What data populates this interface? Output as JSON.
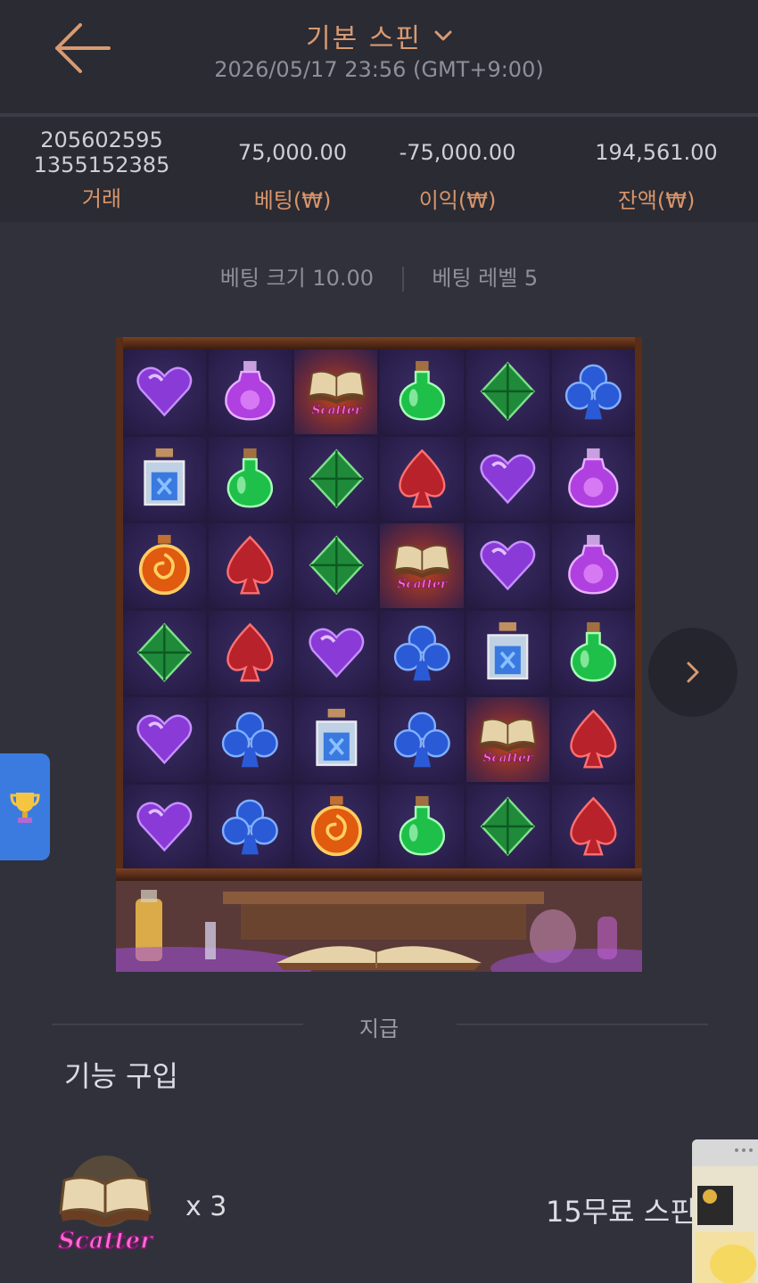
{
  "header": {
    "title": "기본 스핀",
    "datetime": "2026/05/17 23:56 (GMT+9:00)"
  },
  "summary": {
    "transaction": {
      "line1": "205602595",
      "line2": "1355152385",
      "label": "거래"
    },
    "bet": {
      "value": "75,000.00",
      "label": "베팅(₩)"
    },
    "profit": {
      "value": "-75,000.00",
      "label": "이익(₩)"
    },
    "balance": {
      "value": "194,561.00",
      "label": "잔액(₩)"
    }
  },
  "bet_info": {
    "size": "베팅 크기 10.00",
    "level": "베팅 레벨 5"
  },
  "grid": [
    [
      "purple-heart",
      "purple-potion",
      "scatter",
      "green-potion",
      "green-diamond",
      "blue-club"
    ],
    [
      "blue-jar",
      "green-potion",
      "green-diamond",
      "red-spade",
      "purple-heart",
      "purple-potion"
    ],
    [
      "orange-flask",
      "red-spade",
      "green-diamond",
      "scatter",
      "purple-heart",
      "purple-potion"
    ],
    [
      "green-diamond",
      "red-spade",
      "purple-heart",
      "blue-club",
      "blue-jar",
      "green-potion"
    ],
    [
      "purple-heart",
      "blue-club",
      "blue-jar",
      "blue-club",
      "scatter",
      "red-spade"
    ],
    [
      "purple-heart",
      "blue-club",
      "orange-flask",
      "green-potion",
      "green-diamond",
      "red-spade"
    ]
  ],
  "scatter_text": "Scatter",
  "payout_label": "지급",
  "feature": {
    "title": "기능 구입",
    "multiplier": "x 3",
    "result": "15무료 스핀"
  },
  "colors": {
    "accent": "#d89a72",
    "bg": "#30313b",
    "header_bg": "#2a2b33"
  }
}
